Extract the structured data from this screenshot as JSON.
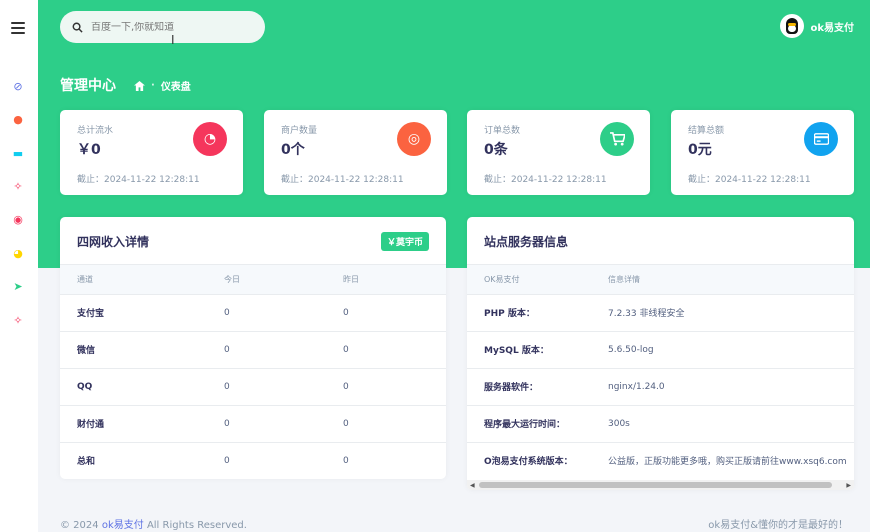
{
  "search": {
    "placeholder": "百度一下,你就知道"
  },
  "user": {
    "name": "ok易支付"
  },
  "header": {
    "title": "管理中心",
    "breadcrumb": "仪表盘"
  },
  "stats": [
    {
      "label": "总计流水",
      "value": "￥0",
      "since": "截止：2024-11-22 12:28:11",
      "color": "#f5365c",
      "icon": "pie-chart-icon"
    },
    {
      "label": "商户数量",
      "value": "0个",
      "since": "截止：2024-11-22 12:28:11",
      "color": "#fb6340",
      "icon": "user-circle-icon"
    },
    {
      "label": "订单总数",
      "value": "0条",
      "since": "截止：2024-11-22 12:28:11",
      "color": "#2dce89",
      "icon": "cart-icon"
    },
    {
      "label": "结算总额",
      "value": "0元",
      "since": "截止：2024-11-22 12:28:11",
      "color": "#11cdef",
      "icon": "credit-card-icon"
    }
  ],
  "income": {
    "title": "四网收入详情",
    "button": "￥莫宇币",
    "headers": [
      "通道",
      "今日",
      "昨日"
    ],
    "rows": [
      {
        "name": "支付宝",
        "today": "0",
        "yesterday": "0"
      },
      {
        "name": "微信",
        "today": "0",
        "yesterday": "0"
      },
      {
        "name": "QQ",
        "today": "0",
        "yesterday": "0"
      },
      {
        "name": "财付通",
        "today": "0",
        "yesterday": "0"
      },
      {
        "name": "总和",
        "today": "0",
        "yesterday": "0"
      }
    ]
  },
  "server": {
    "title": "站点服务器信息",
    "headers": [
      "OK易支付",
      "信息详情"
    ],
    "rows": [
      {
        "name": "PHP 版本：",
        "value": "7.2.33 非线程安全"
      },
      {
        "name": "MySQL 版本：",
        "value": "5.6.50-log"
      },
      {
        "name": "服务器软件：",
        "value": "nginx/1.24.0"
      },
      {
        "name": "程序最大运行时间：",
        "value": "300s"
      },
      {
        "name": "O泡易支付系统版本：",
        "value": "公益版，正版功能更多哦，购买正版请前往www.xsq6.com"
      }
    ]
  },
  "footer": {
    "copyright": "© 2024",
    "brand": "ok易支付",
    "rights": "All Rights Reserved.",
    "slogan": "ok易支付&懂你的才是最好的！"
  },
  "sidebar": {
    "icons": [
      {
        "name": "compass-icon",
        "color": "#5e72e4"
      },
      {
        "name": "user-icon",
        "color": "#fb6340"
      },
      {
        "name": "card-icon",
        "color": "#11cdef"
      },
      {
        "name": "rocket-icon",
        "color": "#f5365c"
      },
      {
        "name": "planet-icon",
        "color": "#f5365c"
      },
      {
        "name": "pie-icon",
        "color": "#ffd600"
      },
      {
        "name": "send-icon",
        "color": "#2dce89"
      },
      {
        "name": "rocket-icon",
        "color": "#f5365c"
      }
    ]
  }
}
